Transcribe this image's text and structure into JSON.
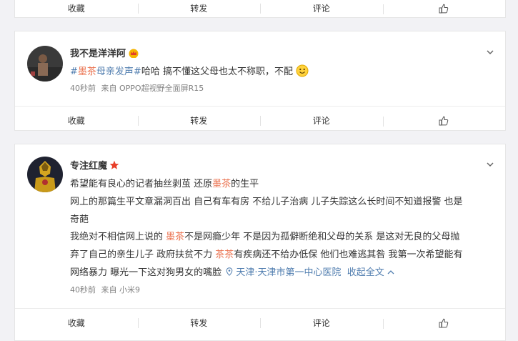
{
  "top_actions": {
    "collect": "收藏",
    "repost": "转发",
    "comment": "评论"
  },
  "post1": {
    "username": "我不是洋洋阿",
    "badge": "crown-icon",
    "text_hashtag_prefix": "#",
    "text_hashtag_red": "墨茶",
    "text_hashtag_rest": "母亲发声#",
    "text_body": "哈哈 搞不懂这父母也太不称职，不配",
    "emoji": "smile-emoji",
    "time": "40秒前",
    "source_label": "来自",
    "source": "OPPO超视野全面屏R15",
    "actions": {
      "collect": "收藏",
      "repost": "转发",
      "comment": "评论"
    }
  },
  "post2": {
    "username": "专注红魔",
    "badge": "star-icon",
    "line1_a": "希望能有良心的记者抽丝剥茧 还原",
    "line1_red": "墨茶",
    "line1_b": "的生平",
    "line2": "网上的那篇生平文章漏洞百出 自己有车有房 不给儿子治病 儿子失踪这么长时间不知道报警 也是",
    "line3": "奇葩",
    "line4_a": "我绝对不相信网上说的 ",
    "line4_red": "墨茶",
    "line4_b": "不是网瘾少年 不是因为孤僻断绝和父母的关系 是这对无良的父母抛",
    "line5_a": "弃了自己的亲生儿子 政府扶贫不力 ",
    "line5_red": "茶茶",
    "line5_b": "有疾病还不给办低保 他们也难逃其咎 我第一次希望能有",
    "line6": "网络暴力 曝光一下这对狗男女的嘴脸",
    "location": "天津·天津市第一中心医院",
    "collapse": "收起全文",
    "time": "40秒前",
    "source_label": "来自",
    "source": "小米9",
    "actions": {
      "collect": "收藏",
      "repost": "转发",
      "comment": "评论"
    }
  },
  "colors": {
    "accent": "#eb7350",
    "link": "#507daf",
    "meta": "#808080"
  }
}
